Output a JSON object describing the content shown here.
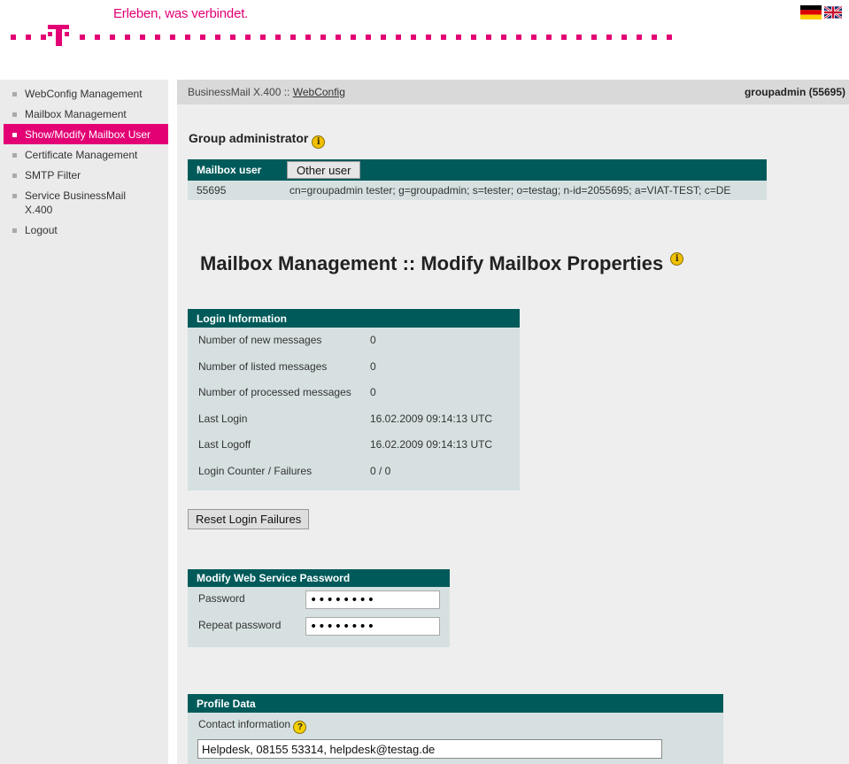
{
  "header": {
    "tagline": "Erleben, was verbindet.",
    "brand_color": "#e20074"
  },
  "sidebar": {
    "items": [
      {
        "label": "WebConfig Management",
        "active": false
      },
      {
        "label": "Mailbox Management",
        "active": false
      },
      {
        "label": "Show/Modify Mailbox User",
        "active": true
      },
      {
        "label": "Certificate Management",
        "active": false
      },
      {
        "label": "SMTP Filter",
        "active": false
      },
      {
        "label": "Service BusinessMail X.400",
        "active": false
      },
      {
        "label": "Logout",
        "active": false
      }
    ]
  },
  "breadcrumb": {
    "prefix": "BusinessMail X.400 :: ",
    "link": "WebConfig",
    "user": "groupadmin (55695)"
  },
  "group": {
    "title": "Group administrator"
  },
  "mailbox_user": {
    "header_label": "Mailbox user",
    "other_button": "Other user",
    "id": "55695",
    "address": "cn=groupadmin tester; g=groupadmin; s=tester; o=testag; n-id=2055695; a=VIAT-TEST; c=DE"
  },
  "page": {
    "title": "Mailbox Management :: Modify Mailbox Properties"
  },
  "login_info": {
    "header": "Login Information",
    "rows": [
      {
        "label": "Number of new messages",
        "value": "0"
      },
      {
        "label": "Number of listed messages",
        "value": "0"
      },
      {
        "label": "Number of processed messages",
        "value": "0"
      },
      {
        "label": "Last Login",
        "value": "16.02.2009 09:14:13 UTC"
      },
      {
        "label": "Last Logoff",
        "value": "16.02.2009 09:14:13 UTC"
      },
      {
        "label": "Login Counter / Failures",
        "value": "0 / 0"
      }
    ],
    "reset_button": "Reset Login Failures"
  },
  "password": {
    "header": "Modify Web Service Password",
    "password_label": "Password",
    "password_value": "••••••••",
    "repeat_label": "Repeat password",
    "repeat_value": "••••••••"
  },
  "profile": {
    "header": "Profile Data",
    "contact_label": "Contact information",
    "contact_value": "Helpdesk, 08155 53314, helpdesk@testag.de"
  },
  "colors": {
    "table_header": "#005a5a",
    "panel_bg": "#d6e0e0",
    "active_nav": "#e20074"
  }
}
